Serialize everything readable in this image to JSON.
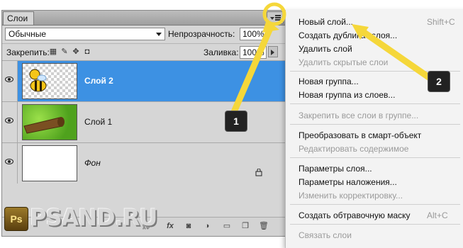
{
  "panel": {
    "tab_label": "Слои",
    "blend_mode": "Обычные",
    "opacity_label": "Непрозрачность:",
    "opacity_value": "100%",
    "lock_label": "Закрепить:",
    "fill_label": "Заливка:",
    "fill_value": "100%",
    "layers": [
      {
        "name": "Слой 2",
        "selected": true,
        "thumbnail": "bee-on-transparent"
      },
      {
        "name": "Слой 1",
        "selected": false,
        "thumbnail": "grass-and-log"
      },
      {
        "name": "Фон",
        "selected": false,
        "thumbnail": "white-fill",
        "locked": true
      }
    ],
    "bottom_icons": [
      "link-icon",
      "fx-icon",
      "mask-icon",
      "adjustment-icon",
      "group-folder-icon",
      "new-layer-icon",
      "trash-icon"
    ]
  },
  "menu": {
    "items": [
      {
        "label": "Новый слой...",
        "shortcut": "Shift+C"
      },
      {
        "label": "Создать дубликат слоя..."
      },
      {
        "label": "Удалить слой"
      },
      {
        "label": "Удалить скрытые слои",
        "disabled": true
      },
      {
        "label": "Новая группа..."
      },
      {
        "label": "Новая группа из слоев..."
      },
      {
        "label": "Закрепить все слои в группе...",
        "disabled": true
      },
      {
        "label": "Преобразовать в смарт-объект"
      },
      {
        "label": "Редактировать содержимое",
        "disabled": true
      },
      {
        "label": "Параметры слоя..."
      },
      {
        "label": "Параметры наложения..."
      },
      {
        "label": "Изменить корректировку...",
        "disabled": true
      },
      {
        "label": "Создать обтравочную маску",
        "shortcut": "Alt+C"
      },
      {
        "label": "Связать слои",
        "disabled": true
      }
    ]
  },
  "annotations": {
    "badge_1": "1",
    "badge_2": "2",
    "arrow_color": "#f5d73a",
    "logo_mark": "Ps",
    "logo_text": "PSAND.RU"
  },
  "colors": {
    "selection": "#3d91e3",
    "panel_bg": "#d6d6d6",
    "menu_bg": "#f3f3f3"
  }
}
